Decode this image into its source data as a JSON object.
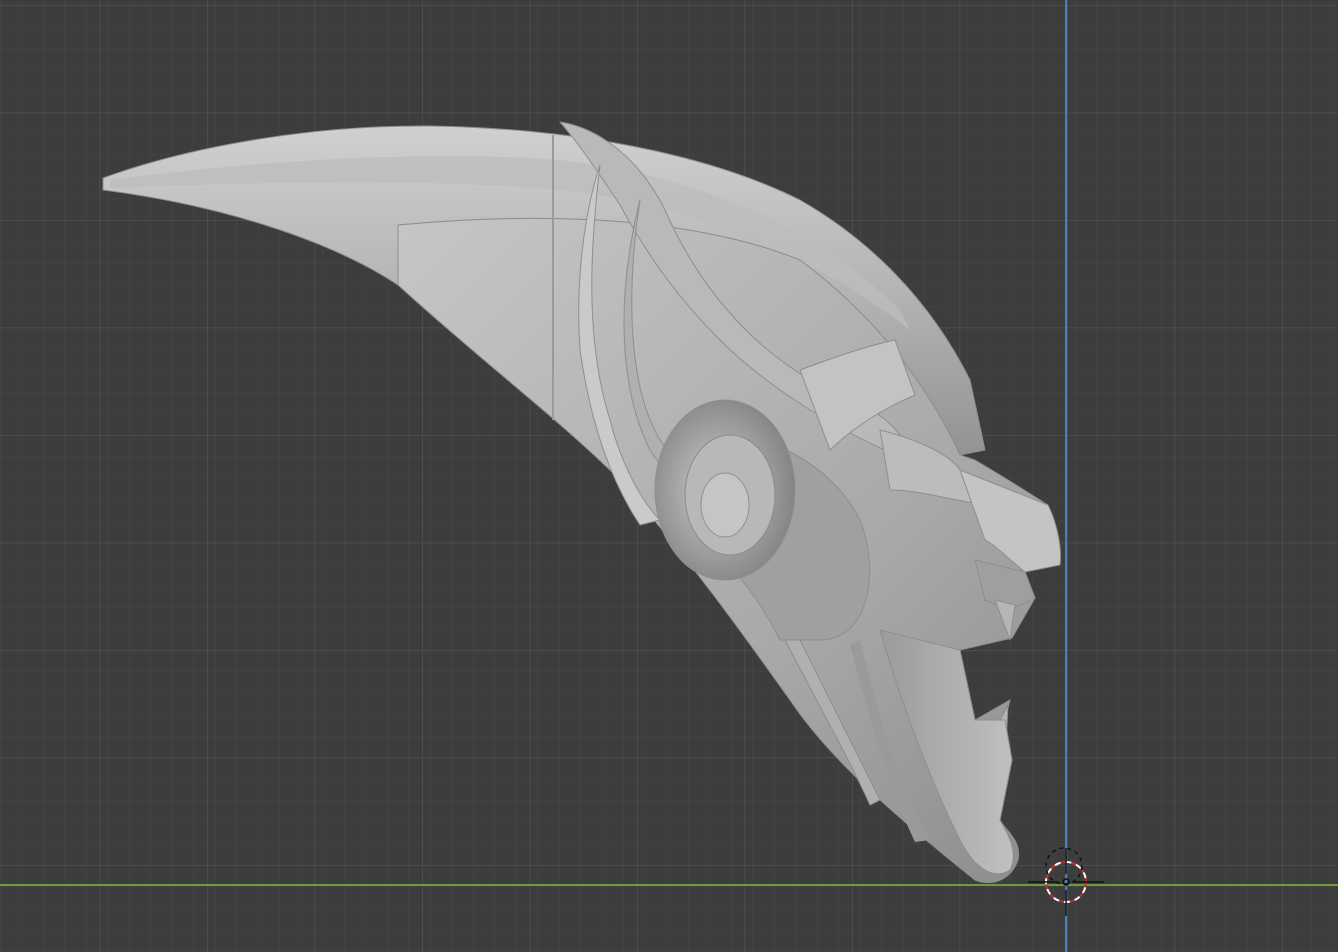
{
  "viewport": {
    "background_color": "#3d3d3d",
    "minor_grid_color": "#474747",
    "major_grid_color": "#545454",
    "x_axis_color": "#6e9a3a",
    "z_axis_color": "#4a7fc0",
    "cursor_primary_color": "#c03030",
    "cursor_secondary_color": "#ffffff"
  },
  "model": {
    "base_color": "#a8a8a8",
    "highlight_color": "#cdcdcd",
    "shadow_color": "#7c7c7c",
    "edge_color": "#8e8e8e"
  }
}
